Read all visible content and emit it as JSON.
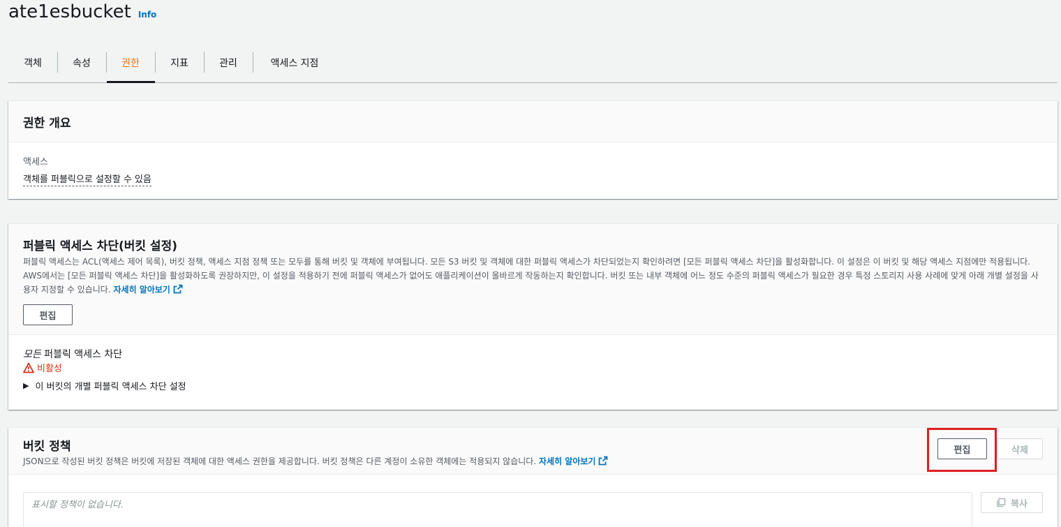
{
  "header": {
    "bucket_name": "ate1esbucket",
    "info_label": "Info"
  },
  "tabs": [
    {
      "label": "객체"
    },
    {
      "label": "속성"
    },
    {
      "label": "권한",
      "active": true
    },
    {
      "label": "지표"
    },
    {
      "label": "관리"
    },
    {
      "label": "액세스 지점"
    }
  ],
  "permissions_overview": {
    "title": "권한 개요",
    "access_label": "액세스",
    "access_value": "객체를 퍼블릭으로 설정할 수 있음"
  },
  "block_public_access": {
    "title": "퍼블릭 액세스 차단(버킷 설정)",
    "description": "퍼블릭 액세스는 ACL(액세스 제어 목록), 버킷 정책, 액세스 지점 정책 또는 모두를 통해 버킷 및 객체에 부여됩니다. 모든 S3 버킷 및 객체에 대한 퍼블릭 액세스가 차단되었는지 확인하려면 [모든 퍼블릭 액세스 차단]을 활성화합니다. 이 설정은 이 버킷 및 해당 액세스 지점에만 적용됩니다. AWS에서는 [모든 퍼블릭 액세스 차단]을 활성화하도록 권장하지만, 이 설정을 적용하기 전에 퍼블릭 액세스가 없어도 애플리케이션이 올바르게 작동하는지 확인합니다. 버킷 또는 내부 객체에 어느 정도 수준의 퍼블릭 액세스가 필요한 경우 특정 스토리지 사용 사례에 맞게 아래 개별 설정을 사용자 지정할 수 있습니다.",
    "learn_more": "자세히 알아보기",
    "edit_label": "편집",
    "setting_title_em": "모든",
    "setting_title_rest": " 퍼블릭 액세스 차단",
    "status": "비활성",
    "expander_label": "이 버킷의 개별 퍼블릭 액세스 차단 설정"
  },
  "bucket_policy": {
    "title": "버킷 정책",
    "description": "JSON으로 작성된 버킷 정책은 버킷에 저장된 객체에 대한 액세스 권한을 제공합니다. 버킷 정책은 다른 계정이 소유한 객체에는 적용되지 않습니다.",
    "learn_more": "자세히 알아보기",
    "edit_label": "편집",
    "delete_label": "삭제",
    "placeholder": "표시할 정책이 없습니다.",
    "copy_label": "복사"
  },
  "colors": {
    "accent": "#ec7211",
    "link": "#0073bb",
    "error": "#d13212",
    "highlight": "#e11d21"
  }
}
